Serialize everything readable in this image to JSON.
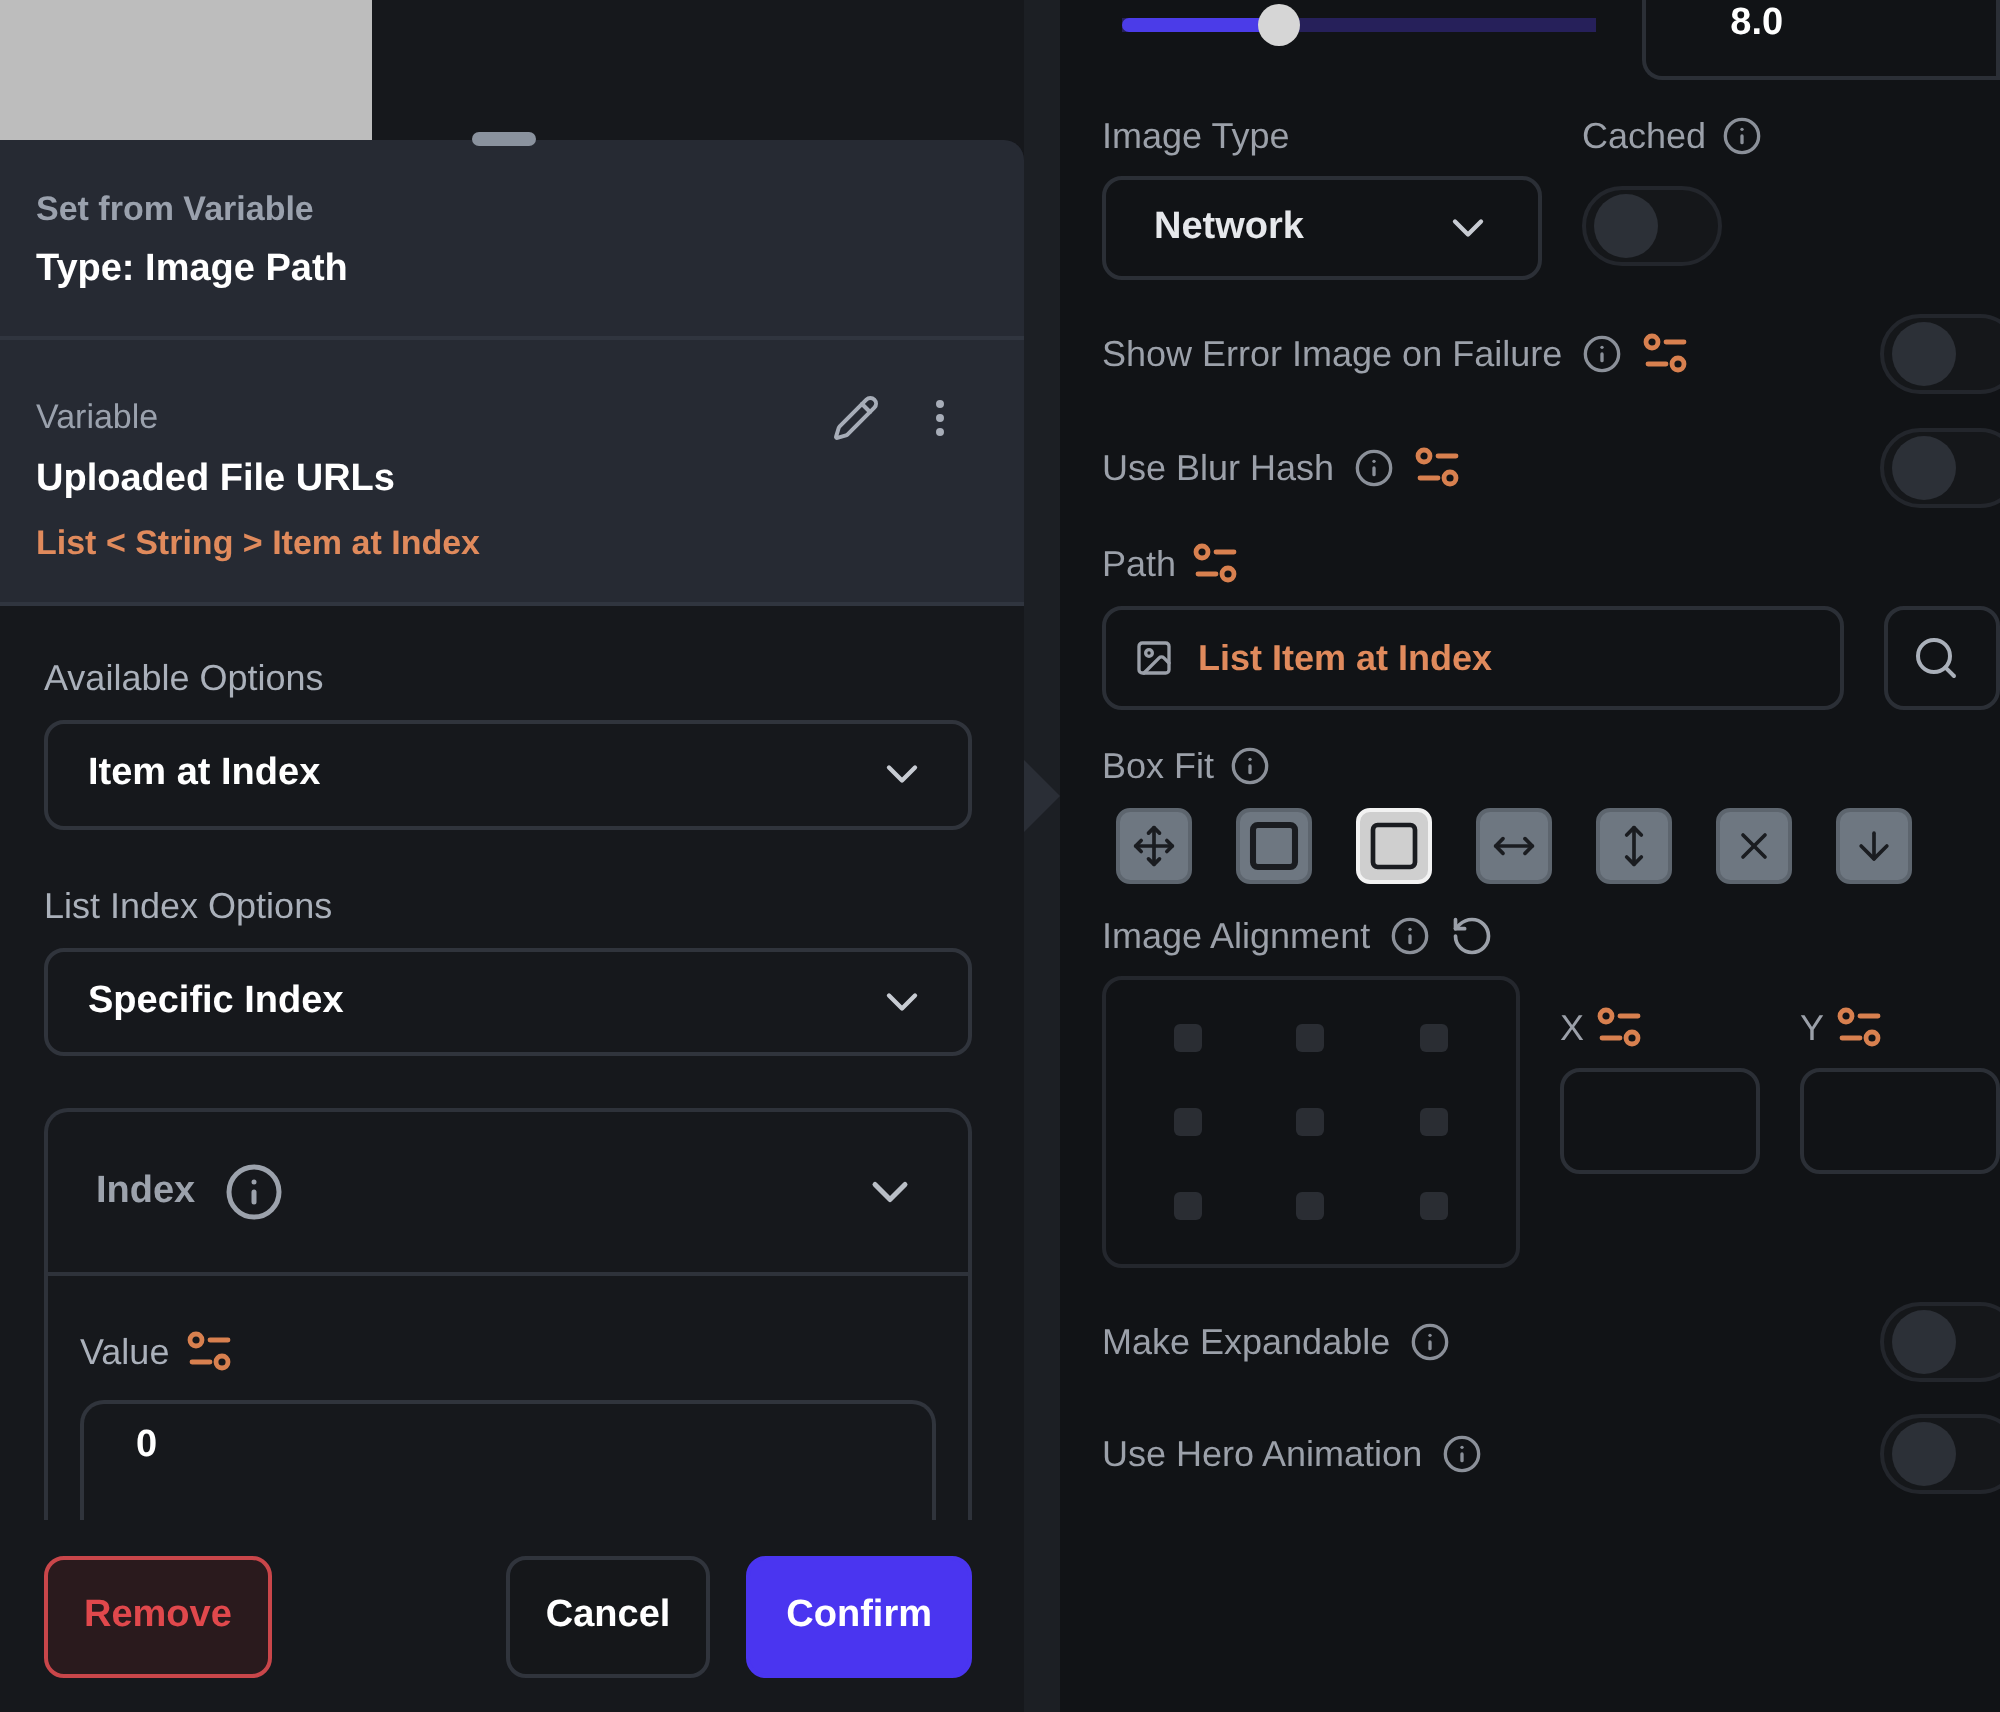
{
  "popup": {
    "subtitle": "Set from Variable",
    "title": "Type: Image Path",
    "variable": {
      "label": "Variable",
      "name": "Uploaded File URLs",
      "path": "List < String > Item at Index"
    },
    "fields": [
      {
        "label": "Available Options",
        "value": "Item at Index"
      },
      {
        "label": "List Index Options",
        "value": "Specific Index"
      }
    ],
    "index": {
      "title": "Index",
      "expanded": true,
      "value_label": "Value",
      "value": "0"
    },
    "buttons": [
      {
        "label": "Remove",
        "kind": "danger"
      },
      {
        "label": "Cancel",
        "kind": "secondary"
      },
      {
        "label": "Confirm",
        "kind": "primary"
      }
    ]
  },
  "properties": {
    "slider": {
      "level": 0.33,
      "value": "8.0"
    },
    "image_type": {
      "label": "Image Type",
      "value": "Network"
    },
    "cached": {
      "label": "Cached",
      "on": false
    },
    "options": [
      {
        "label": "Show Error Image on Failure",
        "on": false,
        "bindable": true
      },
      {
        "label": "Use Blur Hash",
        "on": false,
        "bindable": true
      }
    ],
    "path": {
      "label": "Path",
      "value": "List Item at Index"
    },
    "box_fit": {
      "label": "Box Fit",
      "options": [
        {
          "kind": "fill",
          "selected": false
        },
        {
          "kind": "contain",
          "selected": false
        },
        {
          "kind": "cover",
          "selected": true
        },
        {
          "kind": "fit-width",
          "selected": false
        },
        {
          "kind": "fit-height",
          "selected": false
        },
        {
          "kind": "none",
          "selected": false
        },
        {
          "kind": "scale-down",
          "selected": false
        }
      ]
    },
    "alignment": {
      "label": "Image Alignment",
      "x_label": "X",
      "y_label": "Y"
    },
    "more_options": [
      {
        "label": "Make Expandable",
        "on": false
      },
      {
        "label": "Use Hero Animation",
        "on": false
      }
    ]
  }
}
